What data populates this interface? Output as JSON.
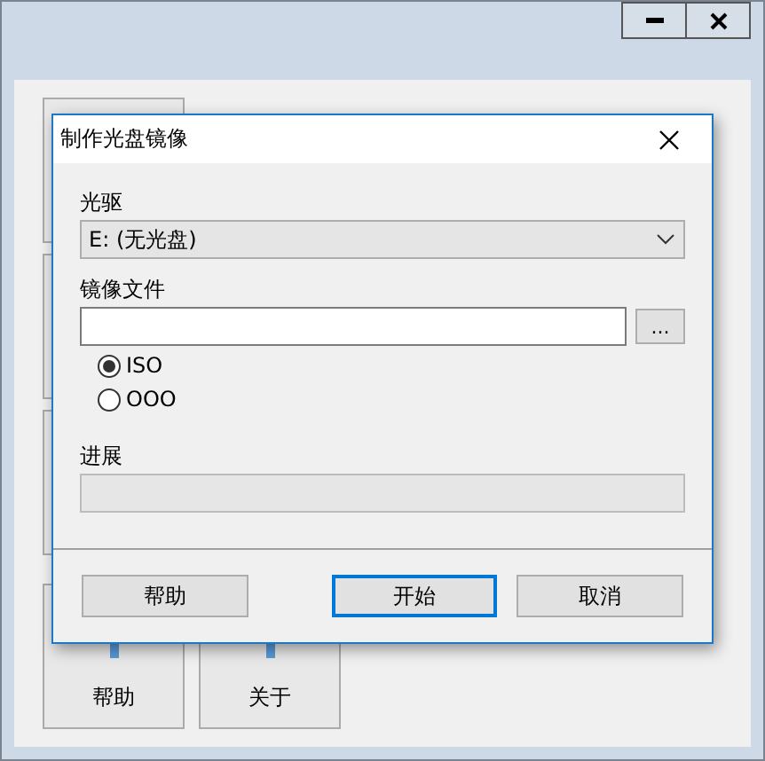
{
  "dialog": {
    "title": "制作光盘镜像",
    "drive": {
      "label": "光驱",
      "value": "E: (无光盘)"
    },
    "image_file": {
      "label": "镜像文件",
      "browse": "..."
    },
    "formats": [
      {
        "label": "ISO",
        "selected": true
      },
      {
        "label": "OOO",
        "selected": false
      }
    ],
    "progress": {
      "label": "进展",
      "level": 0
    },
    "buttons": [
      {
        "label": "帮助",
        "focused": false
      },
      {
        "label": "开始",
        "focused": true
      },
      {
        "label": "取消",
        "focused": false
      }
    ]
  },
  "background_tiles": [
    "帮助",
    "关于"
  ]
}
